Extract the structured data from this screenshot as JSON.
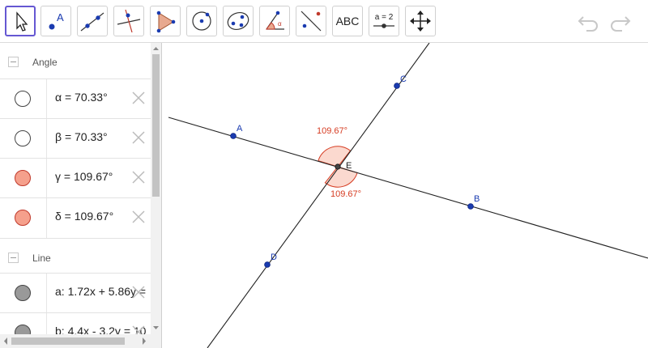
{
  "toolbar": {
    "text_tool_label": "ABC",
    "slider_tool_label": "a = 2"
  },
  "algebra": {
    "groups": [
      {
        "label": "Angle"
      },
      {
        "label": "Line"
      }
    ],
    "rows": [
      {
        "text": "α = 70.33°"
      },
      {
        "text": "β = 70.33°"
      },
      {
        "text": "γ = 109.67°"
      },
      {
        "text": "δ = 109.67°"
      },
      {
        "text": "a: 1.72x + 5.86y ="
      },
      {
        "text": "b: 4.4x - 3.2y = 10"
      }
    ]
  },
  "graphics": {
    "points": {
      "A": "A",
      "B": "B",
      "C": "C",
      "D": "D",
      "E": "E"
    },
    "angle_labels": [
      "109.67°",
      "109.67°"
    ]
  },
  "colors": {
    "accent": "#6557d2",
    "point": "#1a3bb0",
    "angle": "#d63c22",
    "angle_fill": "#fbd9cf"
  }
}
